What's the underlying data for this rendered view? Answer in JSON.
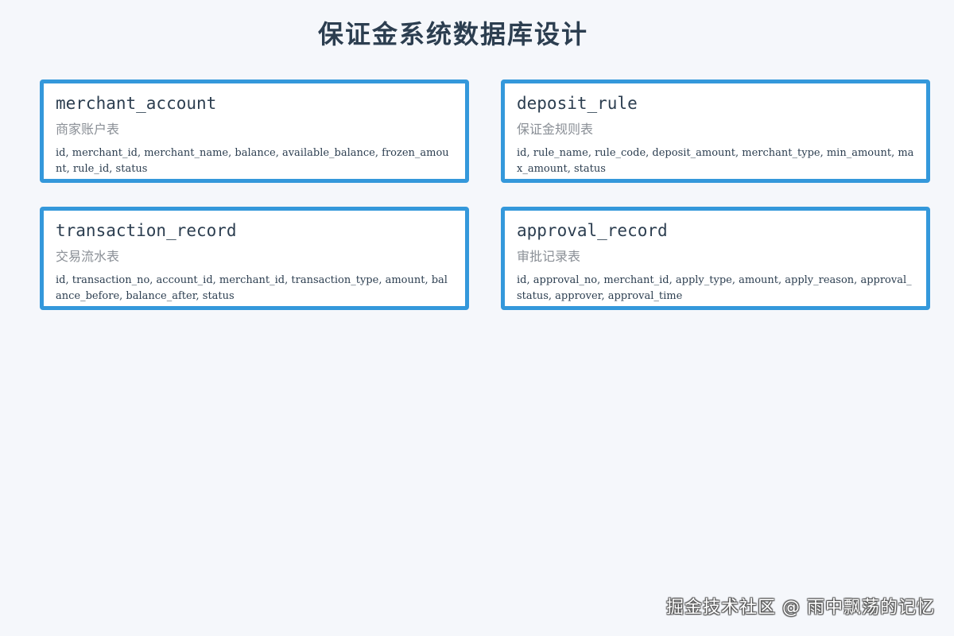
{
  "title": "保证金系统数据库设计",
  "tables": [
    {
      "name": "merchant_account",
      "description": "商家账户表",
      "fields": "id, merchant_id, merchant_name, balance, available_balance, frozen_amount, rule_id, status"
    },
    {
      "name": "deposit_rule",
      "description": "保证金规则表",
      "fields": "id, rule_name, rule_code, deposit_amount, merchant_type, min_amount, max_amount, status"
    },
    {
      "name": "transaction_record",
      "description": "交易流水表",
      "fields": "id, transaction_no, account_id, merchant_id, transaction_type, amount, balance_before, balance_after, status"
    },
    {
      "name": "approval_record",
      "description": "审批记录表",
      "fields": "id, approval_no, merchant_id, apply_type, amount, apply_reason, approval_status, approver, approval_time"
    }
  ],
  "watermark": "掘金技术社区 @ 雨中飘荡的记忆",
  "colors": {
    "background": "#f5f7fb",
    "card_border": "#3498db",
    "title": "#2c3e50",
    "description": "#8a8f96"
  }
}
